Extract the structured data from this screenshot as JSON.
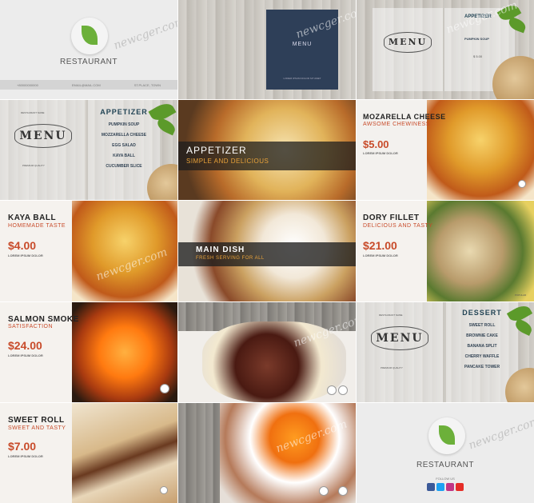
{
  "watermark": "newcger.com",
  "tiles": {
    "t1": {
      "brand": "RESTAURANT",
      "phone": "+80000000000",
      "email": "EMAIL@MAIL.COM",
      "address": "ST.PLACE, TOWN"
    },
    "t2": {
      "menu": "MENU",
      "lorem": "LOREM IPSUM DOLOR SIT AMET"
    },
    "t3": {
      "menu": "MENU",
      "section": "APPETIZER",
      "item": "PUMPKIN SOUP",
      "price": "$ 5.00"
    },
    "t4": {
      "menu": "MENU",
      "badge_top": "RESTAURANT NAME",
      "badge_bottom": "PREMIUM QUALITY",
      "section": "APPETIZER",
      "items": [
        "PUMPKIN SOUP",
        "MOZZARELLA CHEESE",
        "EGG SALAD",
        "KAYA BALL",
        "CUCUMBER SLICE"
      ]
    },
    "t5": {
      "title": "APPETIZER",
      "subtitle": "SIMPLE AND DELICIOUS"
    },
    "t6": {
      "title": "MOZARELLA CHEESE",
      "subtitle": "AWSOME CHEWINESS",
      "price": "$5.00",
      "lorem": "LOREM IPSUM DOLOR"
    },
    "t7": {
      "title": "KAYA BALL",
      "subtitle": "HOMEMADE TASTE",
      "price": "$4.00",
      "lorem": "LOREM IPSUM DOLOR"
    },
    "t8": {
      "title": "MAIN DISH",
      "subtitle": "FRESH SERVING FOR ALL"
    },
    "t9": {
      "title": "DORY FILLET",
      "subtitle": "DELICIOUS AND TASTY",
      "price": "$21.00",
      "lorem": "LOREM IPSUM DOLOR",
      "tag": "POPULAR"
    },
    "t10": {
      "title": "SALMON SMOKE",
      "subtitle": "SATISFACTION",
      "price": "$24.00",
      "lorem": "LOREM IPSUM DOLOR"
    },
    "t12": {
      "menu": "MENU",
      "badge_top": "RESTAURANT NAME",
      "badge_bottom": "PREMIUM QUALITY",
      "section": "DESSERT",
      "items": [
        "SWEET ROLL",
        "BROWNIE CAKE",
        "BANANA SPLIT",
        "CHERRY WAFFLE",
        "PANCAKE TOWER"
      ]
    },
    "t13": {
      "title": "SWEET ROLL",
      "subtitle": "SWEET AND TASTY",
      "price": "$7.00",
      "lorem": "LOREM IPSUM DOLOR"
    },
    "t15": {
      "brand": "RESTAURANT",
      "follow": "FOLLOW US"
    }
  },
  "colors": {
    "accent": "#c84b2a",
    "navy": "#2e3f58",
    "green": "#6cb03a"
  }
}
